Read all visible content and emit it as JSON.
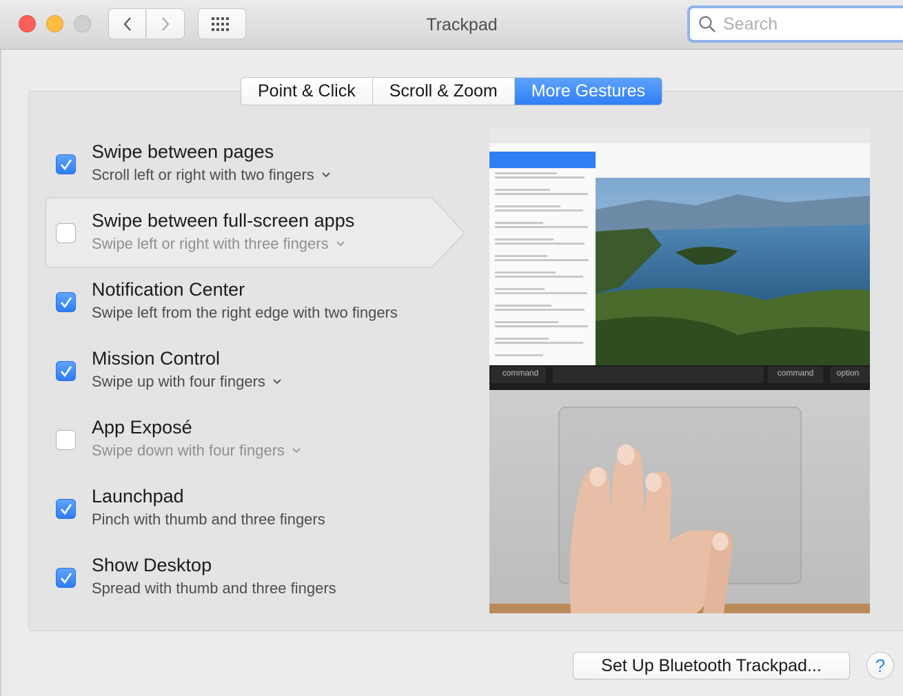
{
  "window": {
    "title": "Trackpad",
    "search_placeholder": "Search"
  },
  "toolbar": {
    "back_icon": "chevron-left-icon",
    "forward_icon": "chevron-right-icon",
    "show_all_icon": "grid-icon"
  },
  "tabs": [
    {
      "label": "Point & Click",
      "active": false
    },
    {
      "label": "Scroll & Zoom",
      "active": false
    },
    {
      "label": "More Gestures",
      "active": true
    }
  ],
  "gestures": [
    {
      "title": "Swipe between pages",
      "subtitle": "Scroll left or right with two fingers",
      "checked": true,
      "has_menu": true
    },
    {
      "title": "Swipe between full-screen apps",
      "subtitle": "Swipe left or right with three fingers",
      "checked": false,
      "has_menu": true
    },
    {
      "title": "Notification Center",
      "subtitle": "Swipe left from the right edge with two fingers",
      "checked": true,
      "has_menu": false
    },
    {
      "title": "Mission Control",
      "subtitle": "Swipe up with four fingers",
      "checked": true,
      "has_menu": true
    },
    {
      "title": "App Exposé",
      "subtitle": "Swipe down with four fingers",
      "checked": false,
      "has_menu": true
    },
    {
      "title": "Launchpad",
      "subtitle": "Pinch with thumb and three fingers",
      "checked": true,
      "has_menu": false
    },
    {
      "title": "Show Desktop",
      "subtitle": "Spread with thumb and three fingers",
      "checked": true,
      "has_menu": false
    }
  ],
  "illustration": {
    "key_left": "command",
    "key_right": "command",
    "key_option": "option"
  },
  "footer": {
    "bluetooth_button": "Set Up Bluetooth Trackpad...",
    "help_label": "?"
  },
  "colors": {
    "accent": "#2f7ff5",
    "close": "#fc605b",
    "minimize": "#fdbc40"
  }
}
